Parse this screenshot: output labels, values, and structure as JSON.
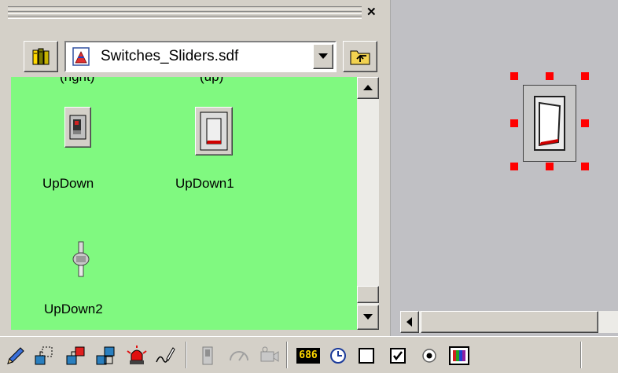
{
  "palette": {
    "file_name": "Switches_Sliders.sdf",
    "partial_captions": [
      "(right)",
      "(up)"
    ],
    "symbols": [
      {
        "label": "UpDown"
      },
      {
        "label": "UpDown1"
      },
      {
        "label": "UpDown2"
      }
    ]
  },
  "toolbar": {
    "numeric_readout": "686"
  },
  "colors": {
    "palette_background": "#80f980",
    "selection_handle": "#ff0000",
    "canvas_background": "#c0c0c4"
  }
}
